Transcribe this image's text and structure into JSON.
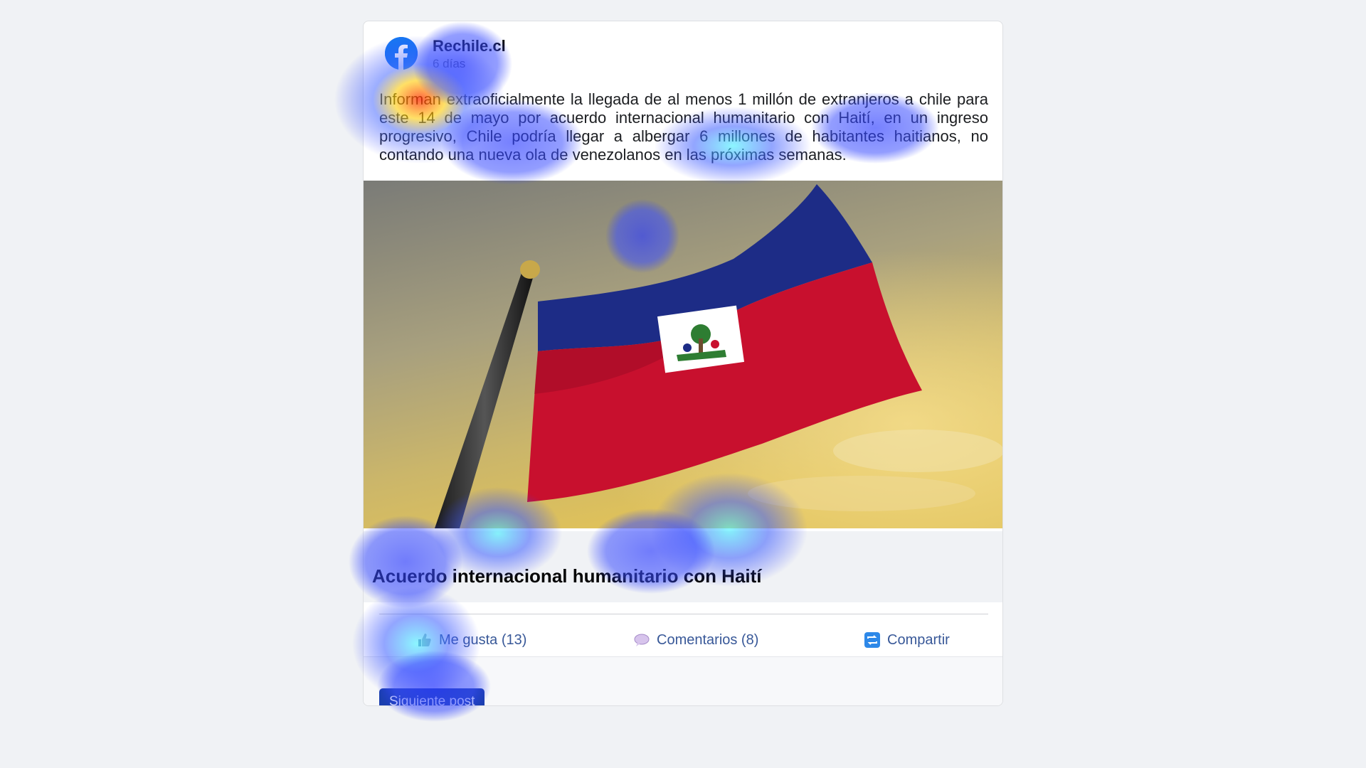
{
  "post": {
    "page_name": "Rechile.cl",
    "timestamp": "6 días",
    "text": "Informan extraoficialmente la llegada de al menos 1 millón de extranjeros a chile para este 14 de mayo por acuerdo internacional humanitario con Haití, en un ingreso progresivo, Chile podría llegar a albergar 6 millones de habitantes haitianos, no contando una nueva ola de venezolanos en las próximas semanas.",
    "avatar_icon": "facebook-logo-icon",
    "image_alt": "haiti-flag-photo",
    "link_title": "Acuerdo internacional humanitario con Haití"
  },
  "actions": {
    "like_label": "Me gusta (13)",
    "like_icon": "thumbs-up-icon",
    "comment_label": "Comentarios (8)",
    "comment_icon": "speech-bubble-icon",
    "share_label": "Compartir",
    "share_icon": "share-arrows-icon"
  },
  "footer": {
    "next_label": "Siguiente post"
  },
  "colors": {
    "facebook_blue": "#1877f2",
    "link_blue": "#385898",
    "button_blue": "#1b3fae",
    "flag_blue": "#00209f",
    "flag_red": "#d21034"
  },
  "overlay": "attention-heatmap"
}
